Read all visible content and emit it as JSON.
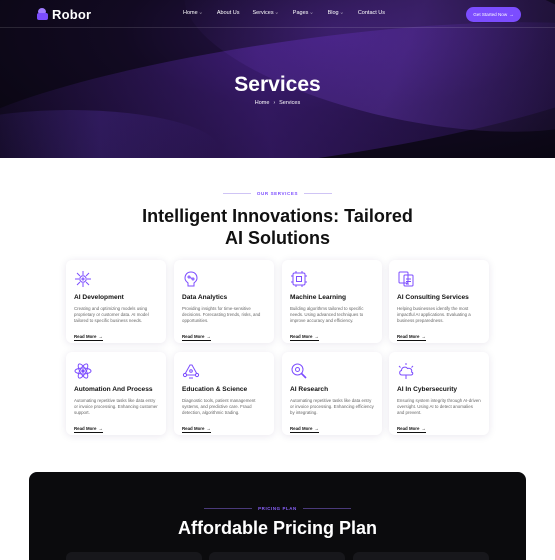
{
  "brand": {
    "name": "Robor",
    "accent": "#7c4dff"
  },
  "nav": {
    "items": [
      {
        "label": "Home",
        "dropdown": true
      },
      {
        "label": "About Us",
        "dropdown": false
      },
      {
        "label": "Services",
        "dropdown": true
      },
      {
        "label": "Pages",
        "dropdown": true
      },
      {
        "label": "Blog",
        "dropdown": true
      },
      {
        "label": "Contact Us",
        "dropdown": false
      }
    ],
    "cta_label": "Get Started Now",
    "cta_arrow": "→"
  },
  "hero": {
    "title": "Services",
    "breadcrumb": {
      "home": "Home",
      "separator": "›",
      "current": "Services"
    }
  },
  "services": {
    "eyebrow": "OUR SERVICES",
    "title_line1": "Intelligent Innovations: Tailored",
    "title_line2": "AI Solutions",
    "read_more": "Read More",
    "arrow": "→",
    "cards": [
      {
        "icon": "ai-brain-icon",
        "title": "AI Development",
        "desc": "Creating and optimizing models using proprietary or customer data. AI model tailored to specific business needs."
      },
      {
        "icon": "data-analytics-icon",
        "title": "Data Analytics",
        "desc": "Providing insights for time-sensitive decisions. Forecasting trends, risks, and opportunities."
      },
      {
        "icon": "machine-learning-icon",
        "title": "Machine Learning",
        "desc": "Building algorithms tailored to specific needs. Using advanced techniques to improve accuracy and efficiency."
      },
      {
        "icon": "ai-consulting-icon",
        "title": "AI Consulting Services",
        "desc": "Helping businesses identify the most impactful AI applications. Evaluating a business preparedness."
      },
      {
        "icon": "automation-icon",
        "title": "Automation And Process",
        "desc": "Automating repetitive tasks like data entry or invoice processing. Enhancing customer support."
      },
      {
        "icon": "education-science-icon",
        "title": "Education & Science",
        "desc": "Diagnostic tools, patient management systems, and predictive care. Fraud detection, algorithmic trading."
      },
      {
        "icon": "ai-research-icon",
        "title": "AI Research",
        "desc": "Automating repetitive tasks like data entry or invoice processing. Enhancing efficiency by integrating."
      },
      {
        "icon": "cybersecurity-icon",
        "title": "AI In Cybersecurity",
        "desc": "Ensuring system integrity through AI-driven oversight. Using AI to detect anomalies and prevent."
      }
    ]
  },
  "pricing": {
    "eyebrow": "PRICING PLAN",
    "title": "Affordable Pricing Plan"
  }
}
